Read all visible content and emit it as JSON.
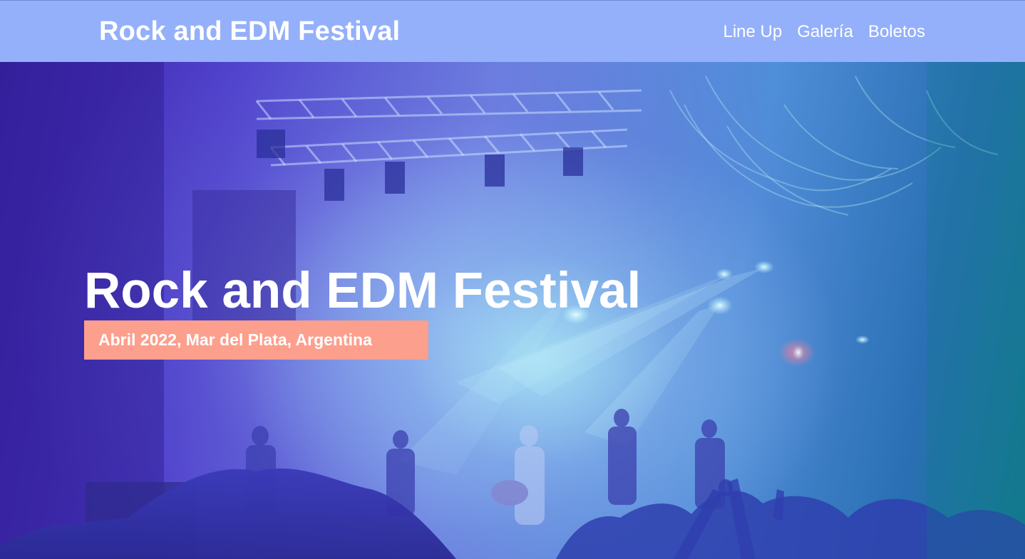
{
  "header": {
    "brand": "Rock and EDM Festival",
    "nav": [
      {
        "label": "Line Up"
      },
      {
        "label": "Galería"
      },
      {
        "label": "Boletos"
      }
    ]
  },
  "hero": {
    "title": "Rock and EDM Festival",
    "subtitle": "Abril 2022, Mar del Plata, Argentina",
    "background_image": "concert-stage-photo"
  },
  "colors": {
    "header_bg": "#94b0fb",
    "badge_bg": "#fc9f8d",
    "text": "#ffffff"
  }
}
